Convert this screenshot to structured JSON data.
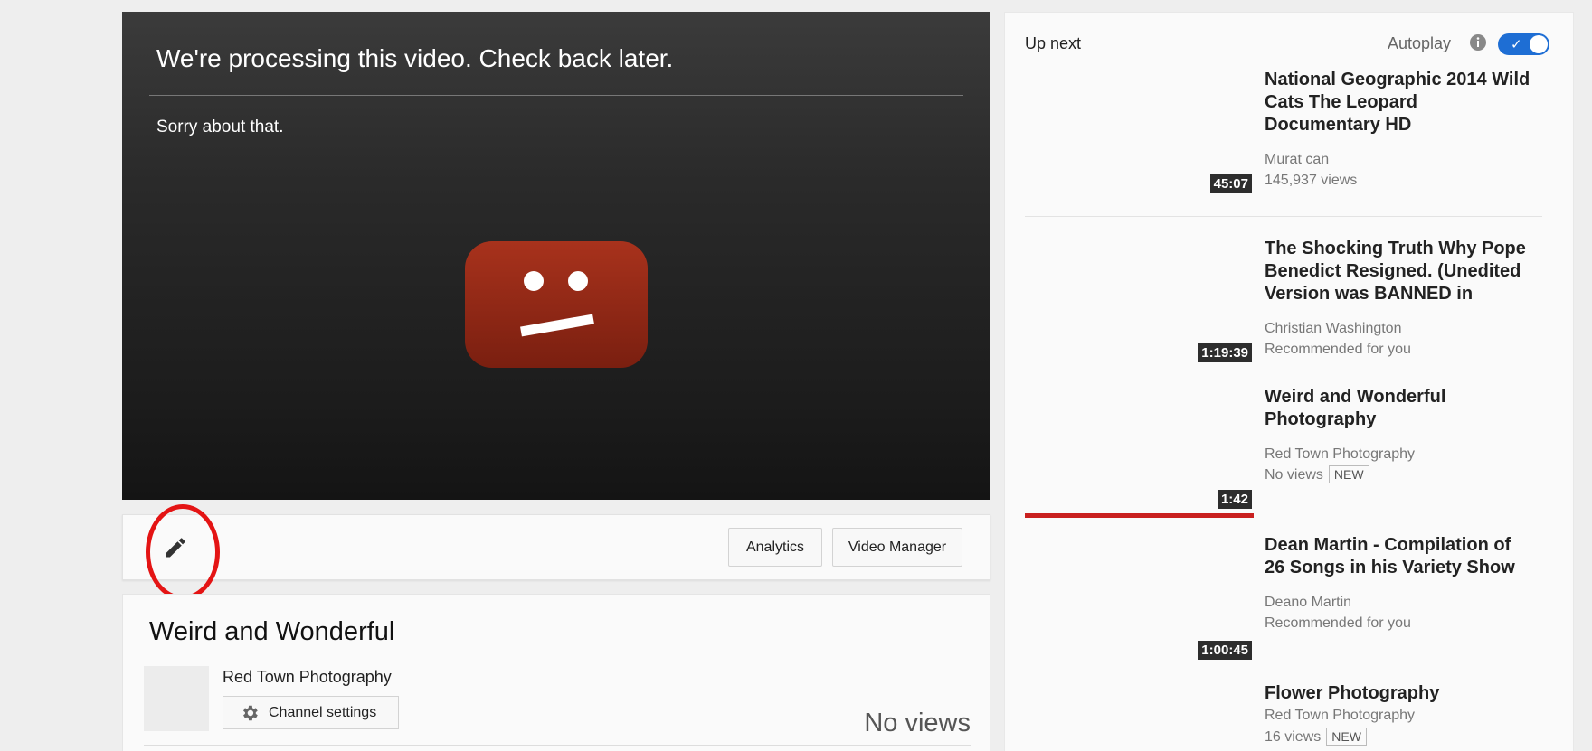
{
  "player": {
    "title": "We're processing this video. Check back later.",
    "subtitle": "Sorry about that."
  },
  "actions": {
    "analytics_label": "Analytics",
    "video_manager_label": "Video Manager"
  },
  "video": {
    "title": "Weird and Wonderful",
    "owner": "Red Town Photography",
    "channel_settings_label": "Channel settings",
    "views": "No views"
  },
  "sidebar": {
    "up_next_label": "Up next",
    "autoplay_label": "Autoplay",
    "autoplay_on": true,
    "items": [
      {
        "title": "National Geographic 2014 Wild Cats The Leopard Documentary HD",
        "channel": "Murat can",
        "meta": "145,937 views",
        "duration": "45:07"
      },
      {
        "title": "The Shocking Truth Why Pope Benedict Resigned. (Unedited Version was BANNED in",
        "channel": "Christian Washington",
        "meta": "Recommended for you",
        "duration": "1:19:39"
      },
      {
        "title": "Weird and Wonderful Photography",
        "channel": "Red Town Photography",
        "meta": "No views",
        "badge": "NEW",
        "duration": "1:42"
      },
      {
        "title": "Dean Martin - Compilation of 26 Songs in his Variety Show",
        "channel": "Deano Martin",
        "meta": "Recommended for you",
        "duration": "1:00:45"
      },
      {
        "title": "Flower Photography",
        "channel": "Red Town Photography",
        "meta": "16 views",
        "badge": "NEW",
        "duration": ""
      }
    ]
  },
  "colors": {
    "accent_red": "#c9201f",
    "toggle_blue": "#1e6ed4",
    "annotation_red": "#e41414"
  }
}
